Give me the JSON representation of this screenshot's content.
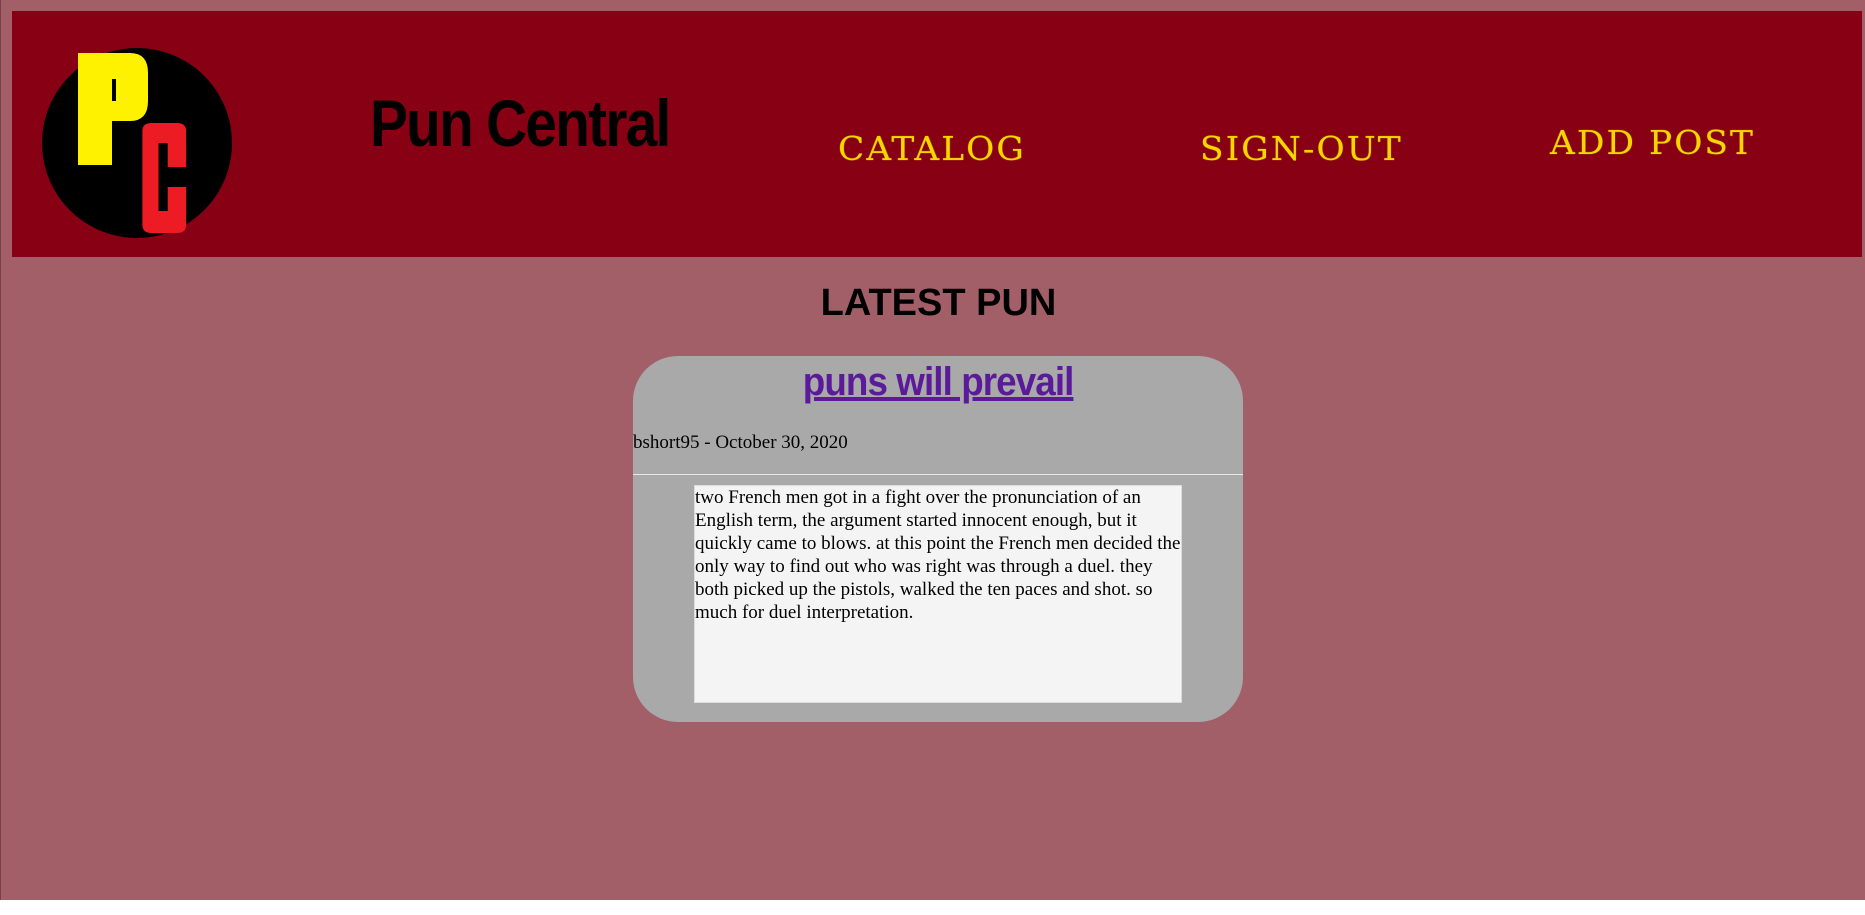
{
  "header": {
    "logo": {
      "letters": [
        "P",
        "C"
      ],
      "colors": {
        "circle": "#000000",
        "p": "#fff200",
        "c": "#ed1c24"
      }
    },
    "brand_name": "Pun Central",
    "nav": [
      {
        "label": "CATALOG"
      },
      {
        "label": "SIGN-OUT"
      },
      {
        "label": "ADD POST"
      }
    ]
  },
  "main": {
    "section_title": "LATEST PUN",
    "post": {
      "title": "puns will prevail",
      "meta": "bshort95 - October 30, 2020",
      "body": "two French men got in a fight over the pronunciation of an English term, the argument started innocent enough, but it quickly came to blows. at this point the French men decided the only way to find out who was right was through a duel. they both picked up the pistols, walked the ten paces and shot. so much for duel interpretation."
    }
  },
  "colors": {
    "page_bg": "#a25f68",
    "header_bg": "#870014",
    "nav_text": "#f6d500",
    "card_bg": "#a9a9a9",
    "link": "#5a1a9a"
  }
}
